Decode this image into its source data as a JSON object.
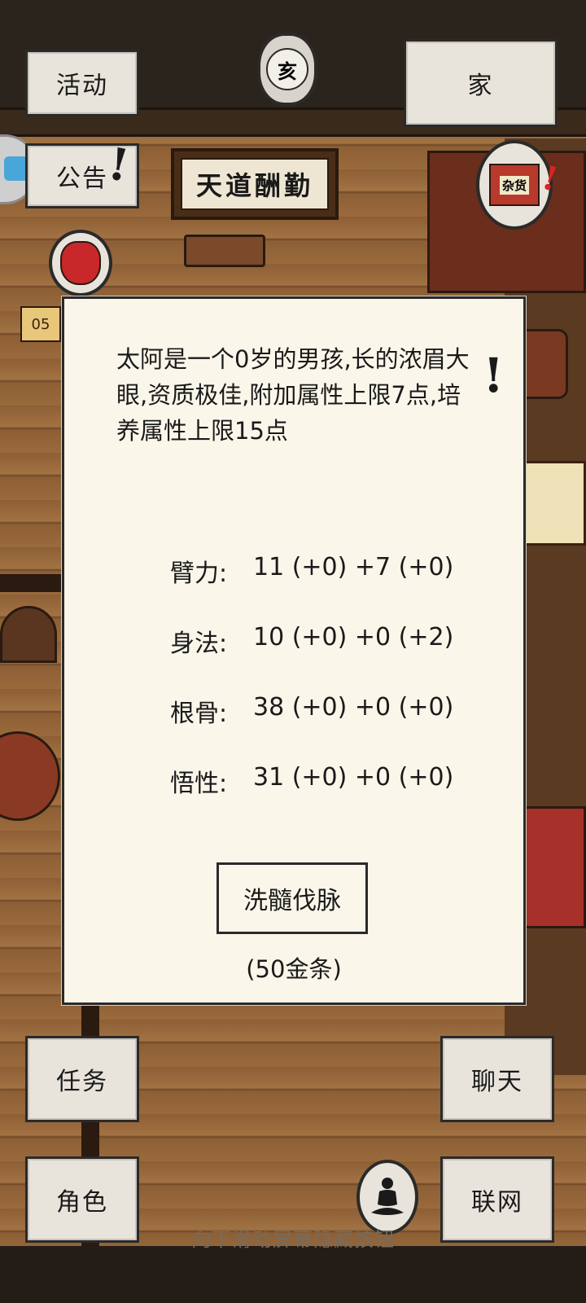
{
  "top": {
    "activity_label": "活动",
    "home_label": "家",
    "seal_char": "亥"
  },
  "notice": {
    "label": "公告",
    "alert": "!"
  },
  "plaque": {
    "text": "天道酬勤"
  },
  "shop": {
    "sign": "杂货",
    "alert": "!"
  },
  "timer": {
    "text": "05"
  },
  "dialog": {
    "description": "太阿是一个0岁的男孩,长的浓眉大眼,资质极佳,附加属性上限7点,培养属性上限15点",
    "alert": "!",
    "stats": [
      {
        "label": "臂力:",
        "value": "11 (+0) +7 (+0)"
      },
      {
        "label": "身法:",
        "value": "10 (+0) +0 (+2)"
      },
      {
        "label": "根骨:",
        "value": "38 (+0) +0 (+0)"
      },
      {
        "label": "悟性:",
        "value": "31 (+0) +0 (+0)"
      }
    ],
    "action_label": "洗髓伐脉",
    "cost": "(50金条)"
  },
  "bottom": {
    "task_label": "任务",
    "chat_label": "聊天",
    "role_label": "角色",
    "network_label": "联网"
  },
  "hint": "向下滑动屏幕隐藏按钮"
}
